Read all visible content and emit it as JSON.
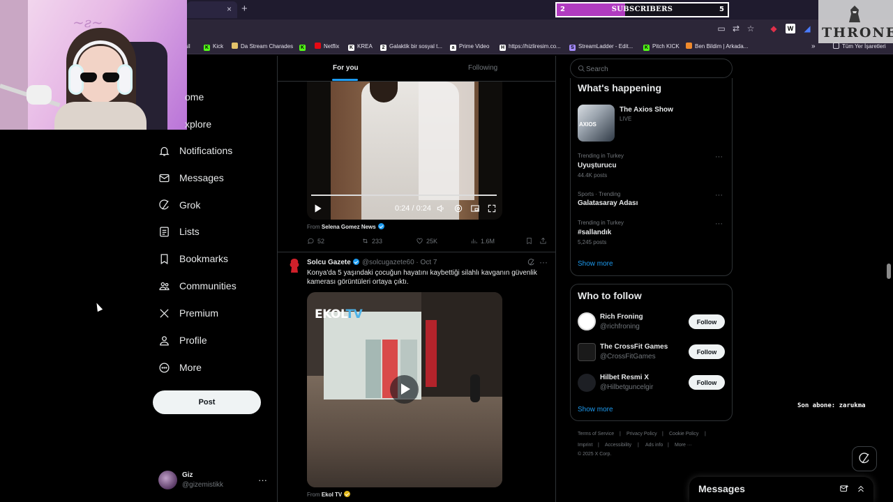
{
  "browser": {
    "tab_close": "×",
    "tab_new": "+",
    "subscribers": {
      "current": "2",
      "label": "SUBSCRIBERS",
      "goal": "5",
      "progress_fraction": 0.4
    },
    "bookmarks": [
      {
        "label": "mail",
        "color": "#cfcfcf"
      },
      {
        "label": "Kick",
        "color": "#53fc18",
        "glyph": "K"
      },
      {
        "label": "Da Stream Charades",
        "color": "#e3c26a"
      },
      {
        "label": "",
        "color": "#53fc18",
        "glyph": "K"
      },
      {
        "label": "Netflix",
        "color": "#e50914"
      },
      {
        "label": "KREA",
        "color": "#ffffff",
        "glyph": "K"
      },
      {
        "label": "Galaktik bir sosyal t...",
        "color": "#ffffff",
        "glyph": "2K"
      },
      {
        "label": "Prime Video",
        "color": "#ffffff",
        "glyph": "a"
      },
      {
        "label": "https://hizliresim.co...",
        "color": "#ffffff",
        "glyph": "H"
      },
      {
        "label": "StreamLadder - Edit...",
        "color": "#a58bff",
        "glyph": "SL"
      },
      {
        "label": "Pitch KICK",
        "color": "#53fc18",
        "glyph": "K"
      },
      {
        "label": "Ben Bildim | Arkada...",
        "color": "#f08a2c"
      }
    ],
    "bookmarks_overflow": "»",
    "bookmarks_all": "Tüm Yer İşaretleri"
  },
  "overlay": {
    "throne": "THRONE",
    "last_sub": "Son abone: zarukma"
  },
  "nav": {
    "home": "ome",
    "explore": "xplore",
    "items": [
      {
        "label": "Notifications",
        "icon": "bell-icon"
      },
      {
        "label": "Messages",
        "icon": "mail-icon"
      },
      {
        "label": "Grok",
        "icon": "grok-icon"
      },
      {
        "label": "Lists",
        "icon": "list-icon"
      },
      {
        "label": "Bookmarks",
        "icon": "bookmark-icon"
      },
      {
        "label": "Communities",
        "icon": "communities-icon"
      },
      {
        "label": "Premium",
        "icon": "x-logo-icon"
      },
      {
        "label": "Profile",
        "icon": "person-icon"
      },
      {
        "label": "More",
        "icon": "more-circle-icon"
      }
    ],
    "post": "Post",
    "account": {
      "name": "Giz",
      "handle": "@gizemistikk",
      "more": "···"
    }
  },
  "timeline": {
    "tabs": {
      "for_you": "For you",
      "following": "Following"
    },
    "post1": {
      "video_time": "0:24 / 0:24",
      "from_label": "From",
      "from_name": "Selena Gomez News",
      "replies": "52",
      "reposts": "233",
      "likes": "25K",
      "views": "1.6M"
    },
    "post2": {
      "name": "Solcu Gazete",
      "handle": "@solcugazete60",
      "date": "Oct 7",
      "text": "Konya'da 5 yaşındaki çocuğun hayatını kaybettiği silahlı kavganın güvenlik kamerası görüntüleri ortaya çıktı.",
      "video_logo_a": "EKOL",
      "video_logo_b": "TV",
      "from_label": "From",
      "from_name": "Ekol TV"
    }
  },
  "sidebar": {
    "search_placeholder": "Search",
    "whats_happening": "What's happening",
    "live_item": {
      "name": "The Axios Show",
      "status": "LIVE",
      "thumb_text": "AXIOS"
    },
    "trends": [
      {
        "context": "Trending in Turkey",
        "name": "Uyuşturucu",
        "count": "44.4K posts"
      },
      {
        "context": "Sports · Trending",
        "name": "Galatasaray Adası",
        "count": ""
      },
      {
        "context": "Trending in Turkey",
        "name": "#sallandık",
        "count": "5,245 posts"
      }
    ],
    "show_more": "Show more",
    "who_to_follow": "Who to follow",
    "suggestions": [
      {
        "name": "Rich Froning",
        "handle": "@richfroning",
        "follow": "Follow"
      },
      {
        "name": "The CrossFit Games",
        "handle": "@CrossFitGames",
        "follow": "Follow"
      },
      {
        "name": "Hilbet Resmi X",
        "handle": "@Hilbetguncelgir",
        "follow": "Follow"
      }
    ],
    "show_more_2": "Show more",
    "footer": {
      "terms": "Terms of Service",
      "privacy": "Privacy Policy",
      "cookie": "Cookie Policy",
      "imprint": "Imprint",
      "accessibility": "Accessibility",
      "ads": "Ads info",
      "more": "More ···",
      "copyright": "© 2025 X Corp."
    }
  },
  "messages_drawer": {
    "title": "Messages"
  },
  "colors": {
    "accent": "#1d9bf0",
    "background": "#000000",
    "sub_bar": "#b03bc0"
  }
}
